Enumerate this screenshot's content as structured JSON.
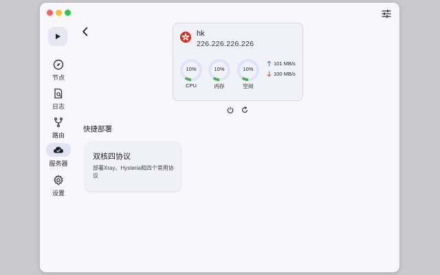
{
  "nav": {
    "items": [
      {
        "label": "节点",
        "icon": "compass-icon"
      },
      {
        "label": "日志",
        "icon": "document-search-icon"
      },
      {
        "label": "路由",
        "icon": "fork-icon"
      },
      {
        "label": "服务器",
        "icon": "cloud-icon",
        "active": true
      },
      {
        "label": "设置",
        "icon": "gear-icon"
      }
    ]
  },
  "server": {
    "name": "hk",
    "ip": "226.226.226.226",
    "flag": "hong-kong-flag-icon",
    "gauges": [
      {
        "label": "CPU",
        "value": "10%",
        "fraction": 0.1
      },
      {
        "label": "内存",
        "value": "10%",
        "fraction": 0.1
      },
      {
        "label": "空间",
        "value": "10%",
        "fraction": 0.1
      }
    ],
    "upload": "101 MB/s",
    "download": "100 MB/s"
  },
  "quick_deploy": {
    "title": "快捷部署",
    "card": {
      "title": "双核四协议",
      "description": "部署Xray、Hysteria和四个常用协议"
    }
  },
  "colors": {
    "accent": "#4caf50",
    "gauge_track": "#dbe4fb",
    "upload_arrow": "#3b82f6",
    "download_arrow": "#e05252",
    "flag_red": "#de2910"
  }
}
